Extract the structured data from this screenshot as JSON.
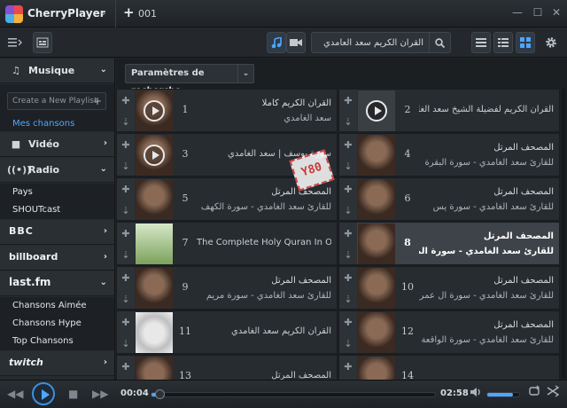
{
  "app": {
    "title": "CherryPlayer",
    "tab_label": "001"
  },
  "search": {
    "value": "القرآن الكريم سعد العامدي"
  },
  "sidebar": {
    "musique": "Musique",
    "create_playlist": "Create a New Playlist",
    "mes_chansons": "Mes chansons",
    "video": "Vidéo",
    "radio": "Radio",
    "radio_sub": [
      "Pays",
      "SHOUTcast"
    ],
    "bbc": "BBC",
    "billboard": "billboard",
    "lastfm": "last.fm",
    "lastfm_sub": [
      "Chansons Aimée",
      "Chansons Hype",
      "Top Chansons"
    ],
    "twitch": "twitch"
  },
  "content": {
    "params_label": "Paramètres de recherche"
  },
  "tracks": [
    {
      "num": "1",
      "line1": "القرآن الكريم كاملا",
      "line2": "سعد الغامدي",
      "selected": false
    },
    {
      "num": "2",
      "line1": "القرآن الكريم لفضيلة الشيخ سعد الغامدي \\",
      "line2": "",
      "selected": false
    },
    {
      "num": "3",
      "line1": "سورة يوسف | سعد الغامدي",
      "line2": "",
      "selected": false
    },
    {
      "num": "4",
      "line1": "المصحف المرتل",
      "line2": "للقارئ سعد الغامدي - سورة البقرة",
      "selected": false
    },
    {
      "num": "5",
      "line1": "المصحف المرتل",
      "line2": "للقارئ سعد الغامدي - سورة الكهف",
      "selected": false
    },
    {
      "num": "6",
      "line1": "المصحف المرتل",
      "line2": "للقارئ سعد الغامدي - سورة يس",
      "selected": false
    },
    {
      "num": "7",
      "line1": "The Complete Holy Quran In One Video",
      "line2": "",
      "selected": false
    },
    {
      "num": "8",
      "line1": "المصحف المرتل",
      "line2": "للقارئ سعد الغامدي - سورة الملك",
      "selected": true
    },
    {
      "num": "9",
      "line1": "المصحف المرتل",
      "line2": "للقارئ سعد الغامدي - سورة مريم",
      "selected": false
    },
    {
      "num": "10",
      "line1": "المصحف المرتل",
      "line2": "للقارئ سعد الغامدي - سورة آل عمران",
      "selected": false
    },
    {
      "num": "11",
      "line1": "القرآن الكريم سعد الغامدي",
      "line2": "",
      "selected": false
    },
    {
      "num": "12",
      "line1": "المصحف المرتل",
      "line2": "للقارئ سعد الغامدي - سورة الواقعة",
      "selected": false
    },
    {
      "num": "13",
      "line1": "المصحف المرتل",
      "line2": "",
      "selected": false
    },
    {
      "num": "14",
      "line1": "",
      "line2": "",
      "selected": false
    }
  ],
  "watermark": "Y80",
  "player": {
    "elapsed": "00:04",
    "total": "02:58",
    "progress": 0.02,
    "volume": 0.8
  },
  "colors": {
    "accent": "#4ea6ff",
    "background": "#202428",
    "selected_row": "#3d4349"
  }
}
